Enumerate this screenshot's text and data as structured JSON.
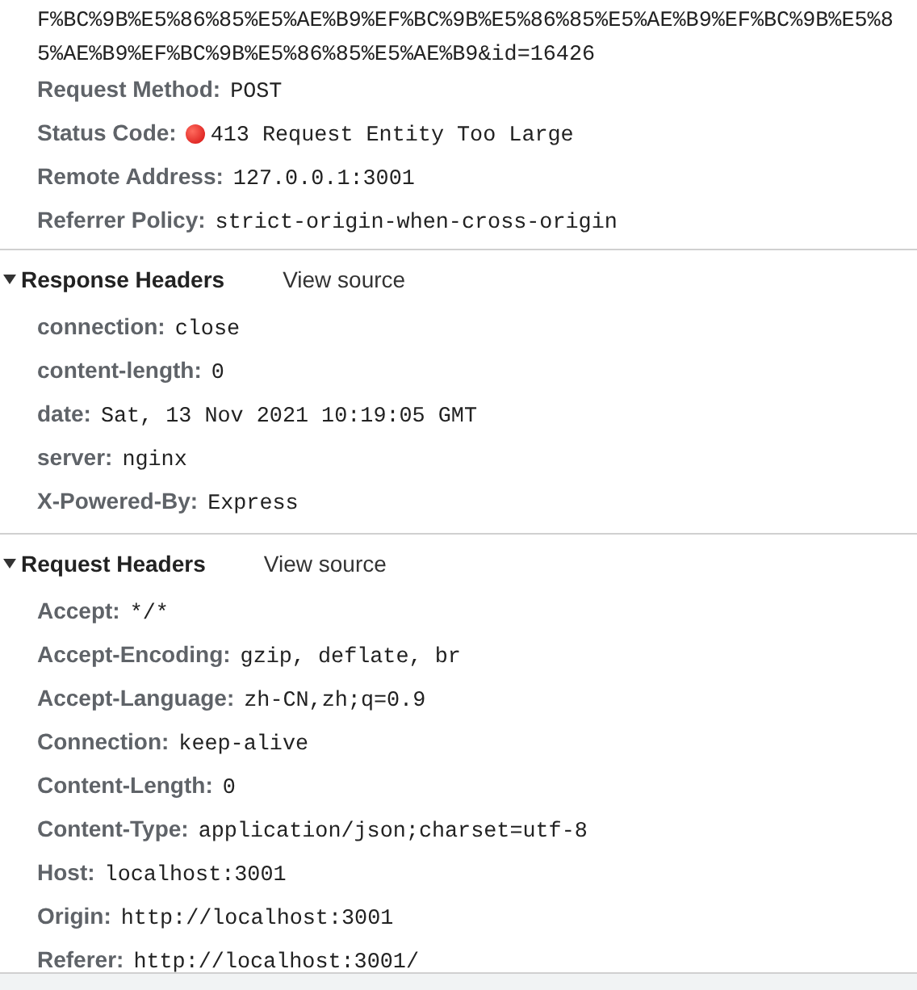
{
  "general": {
    "url_lines": [
      "F%BC%9B%E5%86%85%E5%AE%B9%EF%BC%9B%E5%86%85%E5%AE%B9%EF%BC%9B%E5%8",
      "5%AE%B9%EF%BC%9B%E5%86%85%E5%AE%B9&id=16426"
    ],
    "fields": [
      {
        "kind": "plain",
        "label": "Request Method:",
        "value": "POST"
      },
      {
        "kind": "status",
        "label": "Status Code:",
        "value": "413 Request Entity Too Large"
      },
      {
        "kind": "plain",
        "label": "Remote Address:",
        "value": "127.0.0.1:3001"
      },
      {
        "kind": "plain",
        "label": "Referrer Policy:",
        "value": "strict-origin-when-cross-origin"
      }
    ]
  },
  "sections": [
    {
      "title": "Response Headers",
      "expanded": true,
      "link": "View source",
      "headers": [
        {
          "name": "connection:",
          "value": "close"
        },
        {
          "name": "content-length:",
          "value": "0"
        },
        {
          "name": "date:",
          "value": "Sat, 13 Nov 2021 10:19:05 GMT"
        },
        {
          "name": "server:",
          "value": "nginx"
        },
        {
          "name": "X-Powered-By:",
          "value": "Express"
        }
      ]
    },
    {
      "title": "Request Headers",
      "expanded": true,
      "link": "View source",
      "headers": [
        {
          "name": "Accept:",
          "value": "*/*"
        },
        {
          "name": "Accept-Encoding:",
          "value": "gzip, deflate, br"
        },
        {
          "name": "Accept-Language:",
          "value": "zh-CN,zh;q=0.9"
        },
        {
          "name": "Connection:",
          "value": "keep-alive"
        },
        {
          "name": "Content-Length:",
          "value": "0"
        },
        {
          "name": "Content-Type:",
          "value": "application/json;charset=utf-8"
        },
        {
          "name": "Host:",
          "value": "localhost:3001"
        },
        {
          "name": "Origin:",
          "value": "http://localhost:3001"
        },
        {
          "name": "Referer:",
          "value": "http://localhost:3001/"
        }
      ]
    }
  ]
}
